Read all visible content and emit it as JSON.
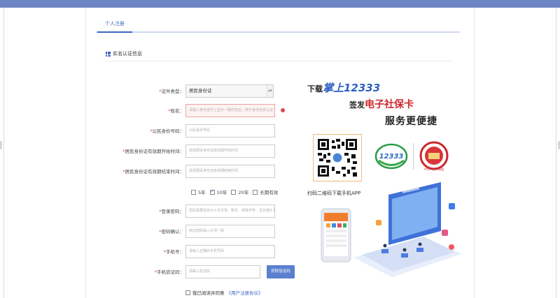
{
  "tabs": [
    {
      "label": "个人注册"
    }
  ],
  "section": {
    "title": "实名认证信息"
  },
  "form": {
    "id_type": {
      "label": "证件类型：",
      "value": "居民身份证"
    },
    "name": {
      "label": "姓名：",
      "placeholder": "请输入身份证件上显示一致的姓名，用于身份信息认证"
    },
    "id_number": {
      "label": "公民身份号码：",
      "placeholder": "公民身份号码"
    },
    "valid_start": {
      "label": "居民身份证有效期开始时间：",
      "placeholder": "选择居民身份证有效期开始时间"
    },
    "valid_end": {
      "label": "居民身份证有效期结束时间：",
      "placeholder": "选择居民身份证有效期结束时间"
    },
    "years": [
      {
        "label": "5年",
        "checked": false
      },
      {
        "label": "10年",
        "checked": true
      },
      {
        "label": "20年",
        "checked": false
      },
      {
        "label": "长期有效",
        "checked": false
      }
    ],
    "password": {
      "label": "登录密码：",
      "placeholder": "密码需要包含大小写字母、数字、特殊字符，且长度8-16位"
    },
    "password_confirm": {
      "label": "密码确认：",
      "placeholder": "两次密码输入必须一致"
    },
    "phone": {
      "label": "手机号：",
      "placeholder": "请输入正确的手机号码"
    },
    "sms_code": {
      "label": "手机验证码：",
      "placeholder": "请输入验证码",
      "button": "获取验证码"
    },
    "agree": {
      "text": "我已阅读并同意",
      "link": "《用户注册协议》"
    }
  },
  "promo": {
    "line1_prefix": "下载",
    "line1_highlight": "掌上12333",
    "line2_prefix": "签发",
    "line2_highlight": "电子社保卡",
    "line3": "服务更便捷",
    "scan_text": "扫码二维码下载手机APP",
    "logo1_text": "12333",
    "logo2_text": "中华人民共和国"
  },
  "colors": {
    "topbar": "#6d85c4",
    "accent": "#3b66c2",
    "error": "#d84b4b",
    "button": "#5b80cf"
  }
}
